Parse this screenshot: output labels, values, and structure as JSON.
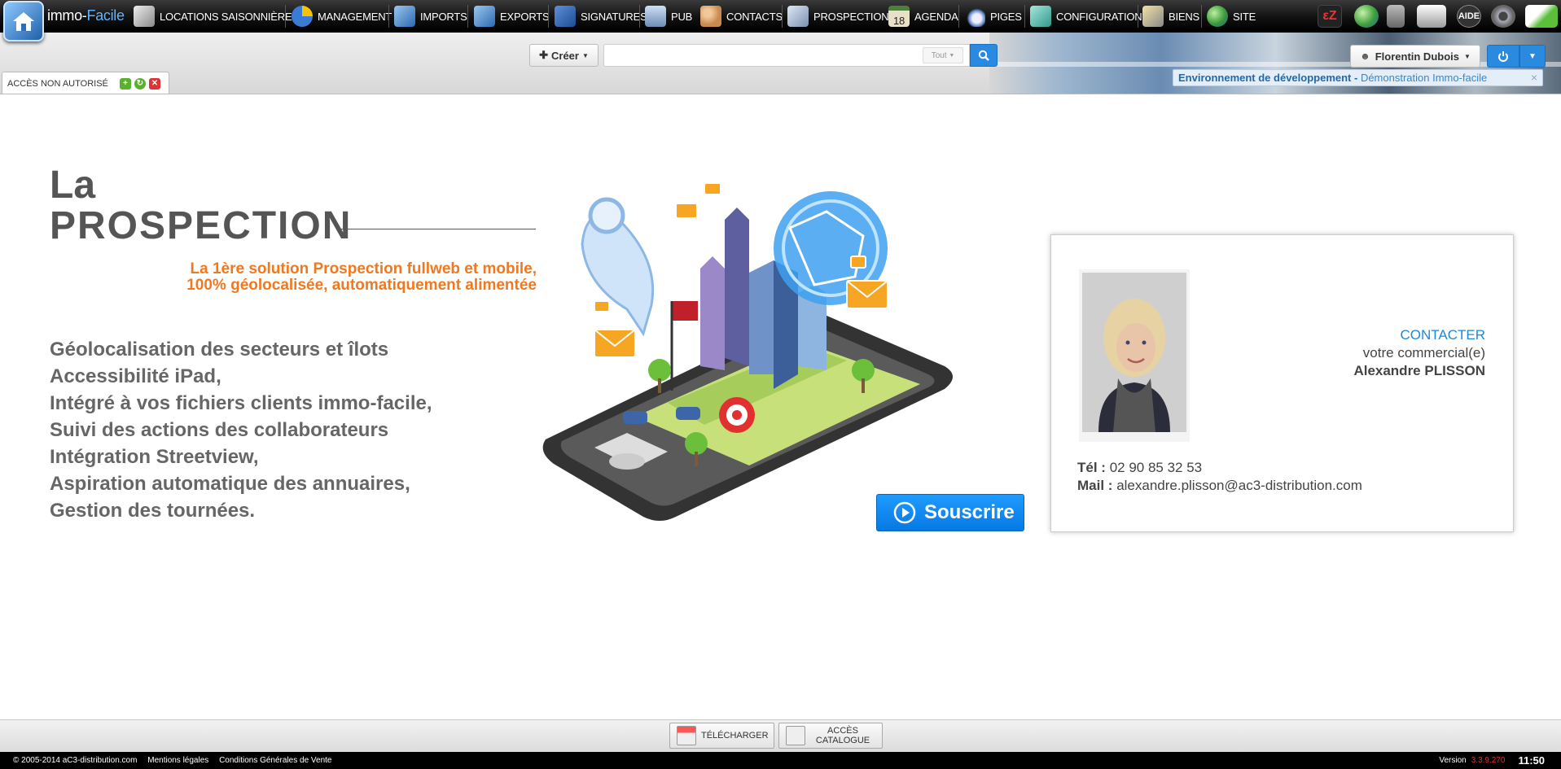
{
  "app": {
    "logo_name_a": "immo-",
    "logo_name_b": "Facile"
  },
  "nav": [
    {
      "label": "LOCATIONS SAISONNIÈRES",
      "icon": "keys-icon",
      "color": "#8aa"
    },
    {
      "label": "MANAGEMENT",
      "icon": "pie-chart-icon",
      "color": "#3a7bd5"
    },
    {
      "label": "IMPORTS",
      "icon": "import-arrow-icon",
      "color": "#4a8fd0"
    },
    {
      "label": "EXPORTS",
      "icon": "export-arrow-icon",
      "color": "#4a8fd0"
    },
    {
      "label": "SIGNATURES",
      "icon": "signature-book-icon",
      "color": "#2e5ea8"
    },
    {
      "label": "PUB",
      "icon": "billboard-icon",
      "color": "#6c8cb5"
    },
    {
      "label": "CONTACTS",
      "icon": "contacts-icon",
      "color": "#c88a50"
    },
    {
      "label": "PROSPECTION",
      "icon": "prospection-icon",
      "color": "#7a8fb0"
    },
    {
      "label": "AGENDA",
      "icon": "calendar-icon",
      "color": "#e9e0c8"
    },
    {
      "label": "PIGES",
      "icon": "magnifier-icon",
      "color": "#5b86c6"
    },
    {
      "label": "CONFIGURATION",
      "icon": "config-icon",
      "color": "#3fb0a0"
    },
    {
      "label": "BIENS",
      "icon": "property-keys-icon",
      "color": "#999"
    },
    {
      "label": "SITE",
      "icon": "globe-icon",
      "color": "#4caf50"
    }
  ],
  "calendar_day": "18",
  "right_icons": {
    "aide": "AIDE"
  },
  "header": {
    "create_label": "Créer",
    "search_placeholder": "",
    "search_scope": "Tout",
    "user_name": "Florentin Dubois"
  },
  "env": {
    "bold": "Environnement de développement",
    "dash": " - ",
    "link": "Démonstration Immo-facile",
    "close": "×"
  },
  "tab": {
    "label": "ACCÈS NON AUTORISÉ"
  },
  "content": {
    "title_la": "La",
    "title_prospection": "PROSPECTION",
    "tagline_1": "La 1ère solution Prospection fullweb et mobile,",
    "tagline_2": "100% géolocalisée, automatiquement alimentée",
    "features": [
      "Géolocalisation des secteurs et îlots",
      "Accessibilité iPad,",
      "Intégré à vos fichiers clients immo-facile,",
      "Suivi des actions des collaborateurs",
      "Intégration Streetview,",
      "Aspiration automatique des annuaires,",
      "Gestion des tournées."
    ],
    "subscribe_label": "Souscrire"
  },
  "contact": {
    "contacter": "CONTACTER",
    "votre": "votre commercial(e)",
    "name": "Alexandre PLISSON",
    "tel_label": "Tél :",
    "tel": "02 90 85 32 53",
    "mail_label": "Mail :",
    "mail": "alexandre.plisson@ac3-distribution.com"
  },
  "bottom": {
    "download": "TÉLÉCHARGER",
    "catalog_1": "ACCÈS",
    "catalog_2": "CATALOGUE"
  },
  "footer": {
    "copyright": "© 2005-2014 aC3-distribution.com",
    "mentions": "Mentions légales",
    "cgv": "Conditions Générales de Vente",
    "version_label": "Version",
    "version": "3.3.9.270",
    "time": "11:50"
  }
}
